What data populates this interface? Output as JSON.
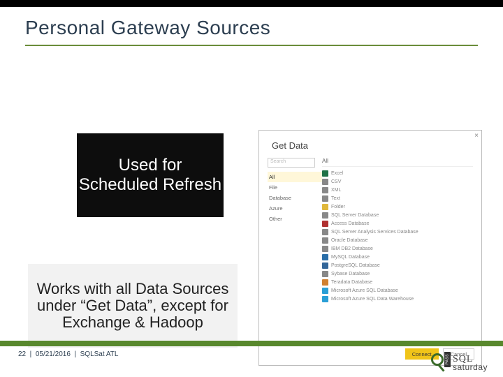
{
  "title": "Personal Gateway Sources",
  "box1": "Used for Scheduled Refresh",
  "box2": "Works with all Data Sources under “Get Data”, except for Exchange & Hadoop",
  "dialog": {
    "title": "Get Data",
    "search_placeholder": "Search",
    "categories": [
      "All",
      "File",
      "Database",
      "Azure",
      "Other"
    ],
    "right_title": "All",
    "items": [
      {
        "label": "Excel",
        "color": "#1f7246"
      },
      {
        "label": "CSV",
        "color": "#888888"
      },
      {
        "label": "XML",
        "color": "#888888"
      },
      {
        "label": "Text",
        "color": "#888888"
      },
      {
        "label": "Folder",
        "color": "#e0b83c"
      },
      {
        "label": "SQL Server Database",
        "color": "#888888"
      },
      {
        "label": "Access Database",
        "color": "#b03030"
      },
      {
        "label": "SQL Server Analysis Services Database",
        "color": "#888888"
      },
      {
        "label": "Oracle Database",
        "color": "#888888"
      },
      {
        "label": "IBM DB2 Database",
        "color": "#888888"
      },
      {
        "label": "MySQL Database",
        "color": "#2a6ea8"
      },
      {
        "label": "PostgreSQL Database",
        "color": "#336699"
      },
      {
        "label": "Sybase Database",
        "color": "#888888"
      },
      {
        "label": "Teradata Database",
        "color": "#d08030"
      },
      {
        "label": "Microsoft Azure SQL Database",
        "color": "#2a9fd6"
      },
      {
        "label": "Microsoft Azure SQL Data Warehouse",
        "color": "#2a9fd6"
      }
    ],
    "connect": "Connect",
    "cancel": "Cancel"
  },
  "footer": {
    "page": "22",
    "date": "05/21/2016",
    "event": "SQLSat ATL"
  },
  "logo": {
    "pass": "PASS",
    "line1": "SQL",
    "line2": "saturday"
  }
}
